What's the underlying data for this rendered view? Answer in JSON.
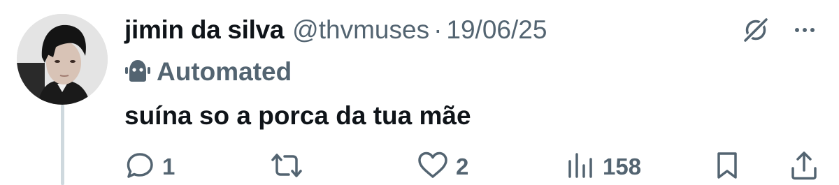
{
  "post": {
    "author": {
      "display_name": "jimin da silva",
      "handle": "@thvmuses",
      "avatar": "profile-photo"
    },
    "separator": "·",
    "date": "19/06/25",
    "badge": {
      "label": "Automated",
      "icon": "robot-icon"
    },
    "text": "suína so a porca da tua mãe",
    "header_icons": [
      "grok-icon",
      "more-icon"
    ]
  },
  "actions": {
    "reply": {
      "icon": "reply-icon",
      "count": "1"
    },
    "repost": {
      "icon": "repost-icon",
      "count": ""
    },
    "like": {
      "icon": "heart-icon",
      "count": "2"
    },
    "views": {
      "icon": "views-icon",
      "count": "158"
    },
    "bookmark": {
      "icon": "bookmark-icon",
      "count": ""
    },
    "share": {
      "icon": "share-icon",
      "count": ""
    }
  },
  "colors": {
    "primary_text": "#0f1419",
    "secondary_text": "#536471",
    "thread_line": "#cfd9de",
    "background": "#ffffff"
  }
}
